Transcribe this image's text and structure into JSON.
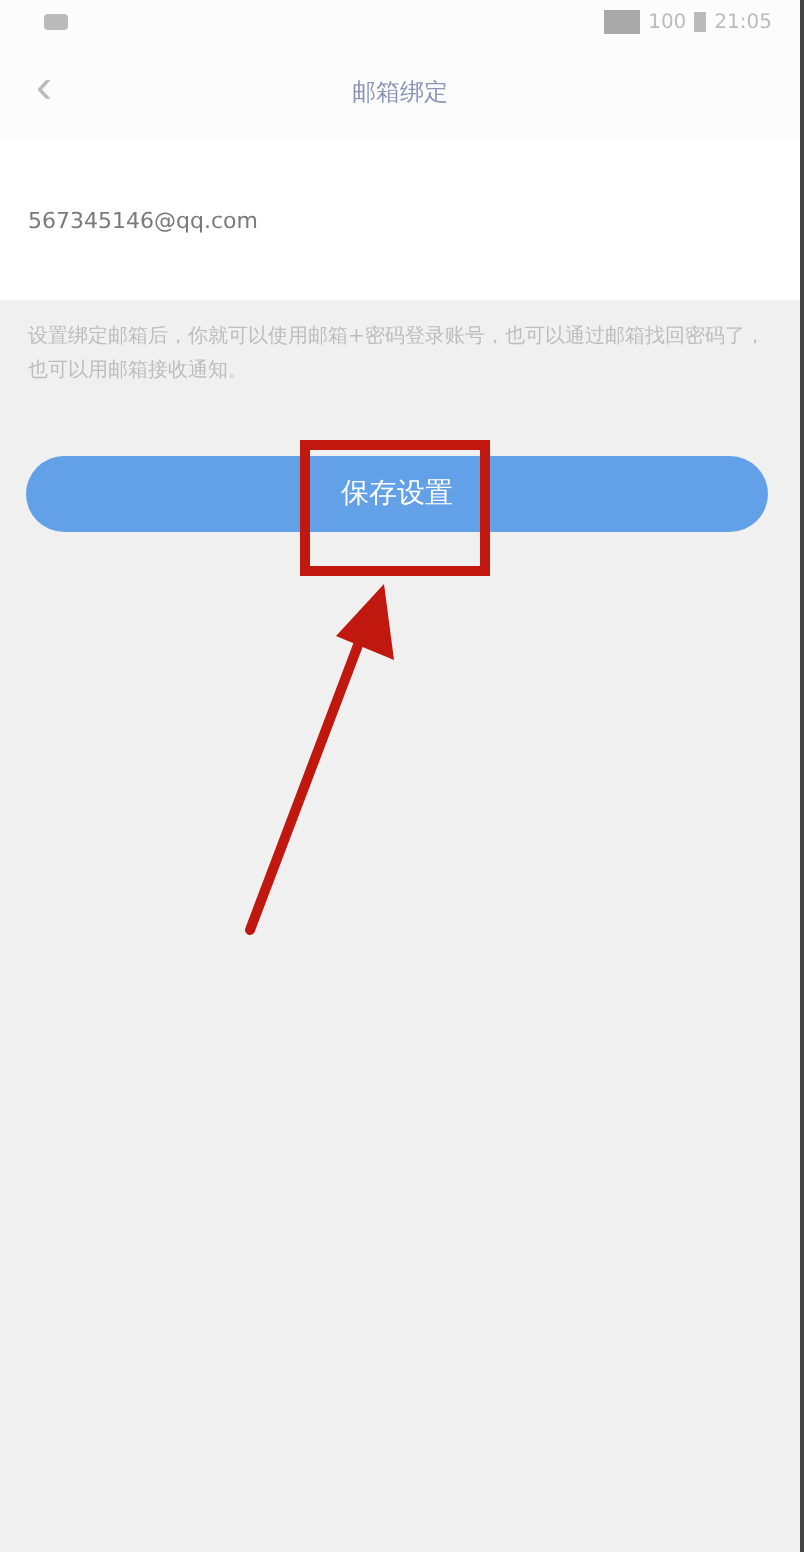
{
  "status_bar": {
    "time": "21:05",
    "battery": "100"
  },
  "nav": {
    "back": "‹",
    "title": "邮箱绑定"
  },
  "email": {
    "value": "567345146@qq.com"
  },
  "hint": "设置绑定邮箱后，你就可以使用邮箱+密码登录账号，也可以通过邮箱找回密码了，也可以用邮箱接收通知。",
  "save_button": {
    "label": "保存设置"
  }
}
